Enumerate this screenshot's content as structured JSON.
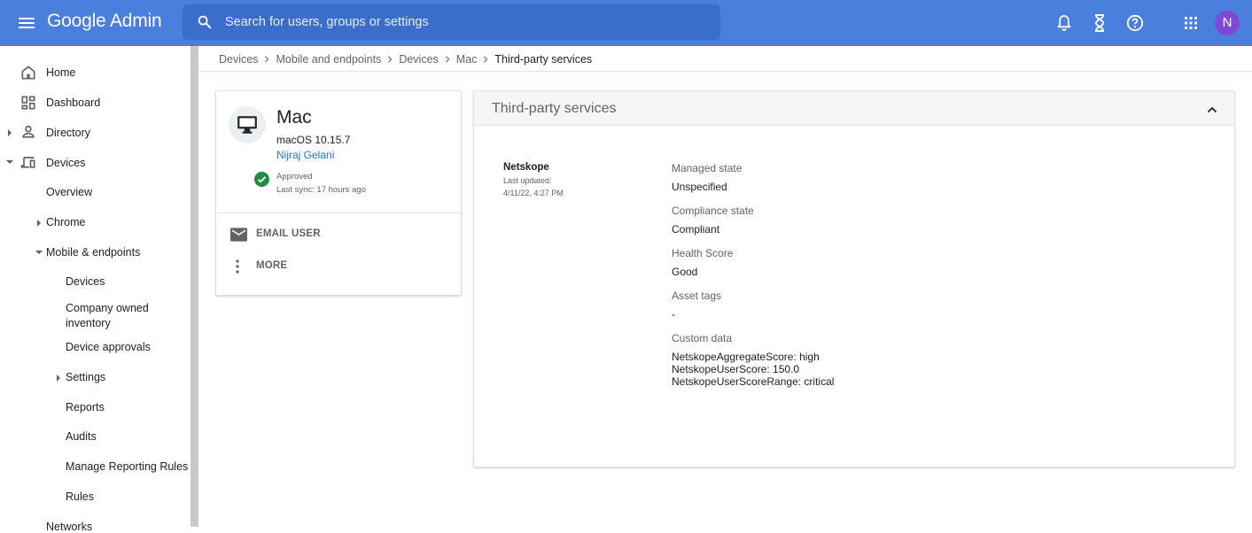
{
  "header": {
    "app_title": "Google Admin",
    "search_placeholder": "Search for users, groups or settings",
    "avatar_initial": "N"
  },
  "sidebar": {
    "items": [
      {
        "label": "Home",
        "icon": "home-icon"
      },
      {
        "label": "Dashboard",
        "icon": "dashboard-icon"
      },
      {
        "label": "Directory",
        "icon": "person-icon"
      },
      {
        "label": "Devices",
        "icon": "devices-icon"
      },
      {
        "label": "Overview"
      },
      {
        "label": "Chrome"
      },
      {
        "label": "Mobile & endpoints"
      },
      {
        "label": "Devices"
      },
      {
        "label": "Company owned inventory"
      },
      {
        "label": "Device approvals"
      },
      {
        "label": "Settings"
      },
      {
        "label": "Reports"
      },
      {
        "label": "Audits"
      },
      {
        "label": "Manage Reporting Rules"
      },
      {
        "label": "Rules"
      },
      {
        "label": "Networks"
      }
    ],
    "company_owned_line1": "Company owned",
    "company_owned_line2": "inventory"
  },
  "breadcrumb": [
    "Devices",
    "Mobile and endpoints",
    "Devices",
    "Mac",
    "Third-party services"
  ],
  "device": {
    "name": "Mac",
    "os": "macOS 10.15.7",
    "user": "Nijraj Gelani",
    "status": "Approved",
    "last_sync": "Last sync: 17 hours ago",
    "actions": {
      "email": "EMAIL USER",
      "more": "MORE"
    }
  },
  "third_party": {
    "title": "Third-party services",
    "service": {
      "name": "Netskope",
      "last_updated_label": "Last updated:",
      "last_updated": "4/11/22, 4:27 PM"
    },
    "fields": [
      {
        "label": "Managed state",
        "value": "Unspecified"
      },
      {
        "label": "Compliance state",
        "value": "Compliant"
      },
      {
        "label": "Health Score",
        "value": "Good"
      },
      {
        "label": "Asset tags",
        "value": "-"
      },
      {
        "label": "Custom data",
        "values": [
          "NetskopeAggregateScore: high",
          "NetskopeUserScore: 150.0",
          "NetskopeUserScoreRange: critical"
        ]
      }
    ]
  },
  "colors": {
    "topbar": "#4a7fdd",
    "search": "#3a6dcc",
    "avatar": "#7c4ad6",
    "link": "#1a73e8",
    "approved": "#1e8e3e"
  }
}
